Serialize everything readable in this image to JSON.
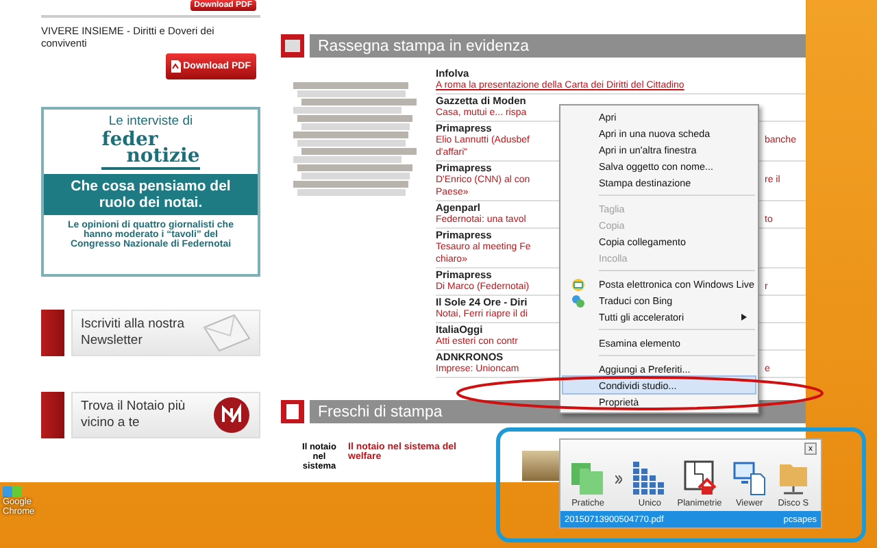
{
  "sidebar": {
    "top_download": "Download PDF",
    "document": {
      "title": "VIVERE INSIEME - Diritti e Doveri dei conviventi",
      "download": "Download PDF"
    },
    "interview_banner": {
      "kicker": "Le interviste di",
      "logo_top": "feder",
      "logo_bottom": "notizie",
      "headline": "Che cosa pensiamo del ruolo dei notai.",
      "body": "Le opinioni di quattro giornalisti che hanno moderato i “tavoli” del Congresso Nazionale di Federnotai"
    },
    "promos": [
      {
        "kind": "newsletter",
        "text": "Iscriviti alla nostra Newsletter"
      },
      {
        "kind": "notary",
        "text": "Trova il Notaio più vicino a te"
      }
    ]
  },
  "press_review": {
    "title": "Rassegna stampa in evidenza",
    "items": [
      {
        "source": "Infolva",
        "lines": [
          {
            "left": "A roma la presentazione della Carta dei Diritti del Cittadino"
          }
        ]
      },
      {
        "source": "Gazzetta di Moden",
        "lines": [
          {
            "left": "Casa, mutui e... rispa"
          }
        ]
      },
      {
        "source": "Primapress",
        "lines": [
          {
            "left": "Elio Lannutti (Adusbef",
            "right": "banche"
          },
          {
            "left": "d'affari\""
          }
        ]
      },
      {
        "source": "Primapress",
        "lines": [
          {
            "left": "D'Enrico (CNN) al con",
            "right": "re il"
          },
          {
            "left": "Paese»"
          }
        ]
      },
      {
        "source": "Agenparl",
        "lines": [
          {
            "left": "Federnotai: una tavol",
            "right": "to"
          }
        ]
      },
      {
        "source": "Primapress",
        "lines": [
          {
            "left": "Tesauro al meeting Fe"
          },
          {
            "left": "chiaro»"
          }
        ]
      },
      {
        "source": "Primapress",
        "lines": [
          {
            "left": "Di Marco (Federnotai)",
            "right": "r"
          }
        ]
      },
      {
        "source": "Il Sole 24 Ore - Diri",
        "lines": [
          {
            "left": "Notai, Ferri riapre il di"
          }
        ]
      },
      {
        "source": "ItaliaOggi",
        "lines": [
          {
            "left": "Atti esteri con contr"
          }
        ]
      },
      {
        "source": "ADNKRONOS",
        "lines": [
          {
            "left": "Imprese: Unioncam",
            "right": "e"
          }
        ]
      }
    ]
  },
  "context_menu": {
    "items": [
      {
        "kind": "item",
        "label": "Apri",
        "disabled": false,
        "selected": false
      },
      {
        "kind": "item",
        "label": "Apri in una nuova scheda",
        "disabled": false,
        "selected": false
      },
      {
        "kind": "item",
        "label": "Apri in un'altra finestra",
        "disabled": false,
        "selected": false
      },
      {
        "kind": "item",
        "label": "Salva oggetto con nome...",
        "disabled": false,
        "selected": false
      },
      {
        "kind": "item",
        "label": "Stampa destinazione",
        "disabled": false,
        "selected": false
      },
      {
        "kind": "separator"
      },
      {
        "kind": "item",
        "label": "Taglia",
        "disabled": true,
        "selected": false
      },
      {
        "kind": "item",
        "label": "Copia",
        "disabled": true,
        "selected": false
      },
      {
        "kind": "item",
        "label": "Copia collegamento",
        "disabled": false,
        "selected": false
      },
      {
        "kind": "item",
        "label": "Incolla",
        "disabled": true,
        "selected": false
      },
      {
        "kind": "separator"
      },
      {
        "kind": "mail",
        "label": "Posta elettronica con Windows Live",
        "disabled": false,
        "selected": false
      },
      {
        "kind": "translate",
        "label": "Traduci con Bing",
        "disabled": false,
        "selected": false
      },
      {
        "kind": "submenu",
        "label": "Tutti gli acceleratori",
        "disabled": false,
        "selected": false
      },
      {
        "kind": "separator"
      },
      {
        "kind": "item",
        "label": "Esamina elemento",
        "disabled": false,
        "selected": false
      },
      {
        "kind": "separator"
      },
      {
        "kind": "item",
        "label": "Aggiungi a Preferiti...",
        "disabled": false,
        "selected": false
      },
      {
        "kind": "item",
        "label": "Condividi studio...",
        "disabled": false,
        "selected": true
      },
      {
        "kind": "item",
        "label": "Proprietà",
        "disabled": false,
        "selected": false
      }
    ]
  },
  "fresh_prints": {
    "title": "Freschi di stampa",
    "caption": "Il notaio nel sistema",
    "link": "Il notaio nel sistema del welfare"
  },
  "launcher": {
    "close": "x",
    "apps": [
      {
        "kind": "folders",
        "label": "Pratiche"
      },
      {
        "kind": "grid",
        "label": "Unico"
      },
      {
        "kind": "floorplan",
        "label": "Planimetrie"
      },
      {
        "kind": "monitor",
        "label": "Viewer"
      },
      {
        "kind": "drive",
        "label": "Disco S"
      }
    ],
    "file": "20150713900504770.pdf",
    "user": "pcsapes"
  },
  "desktop": {
    "icons": [
      {
        "label": "Google Chrome"
      }
    ]
  }
}
